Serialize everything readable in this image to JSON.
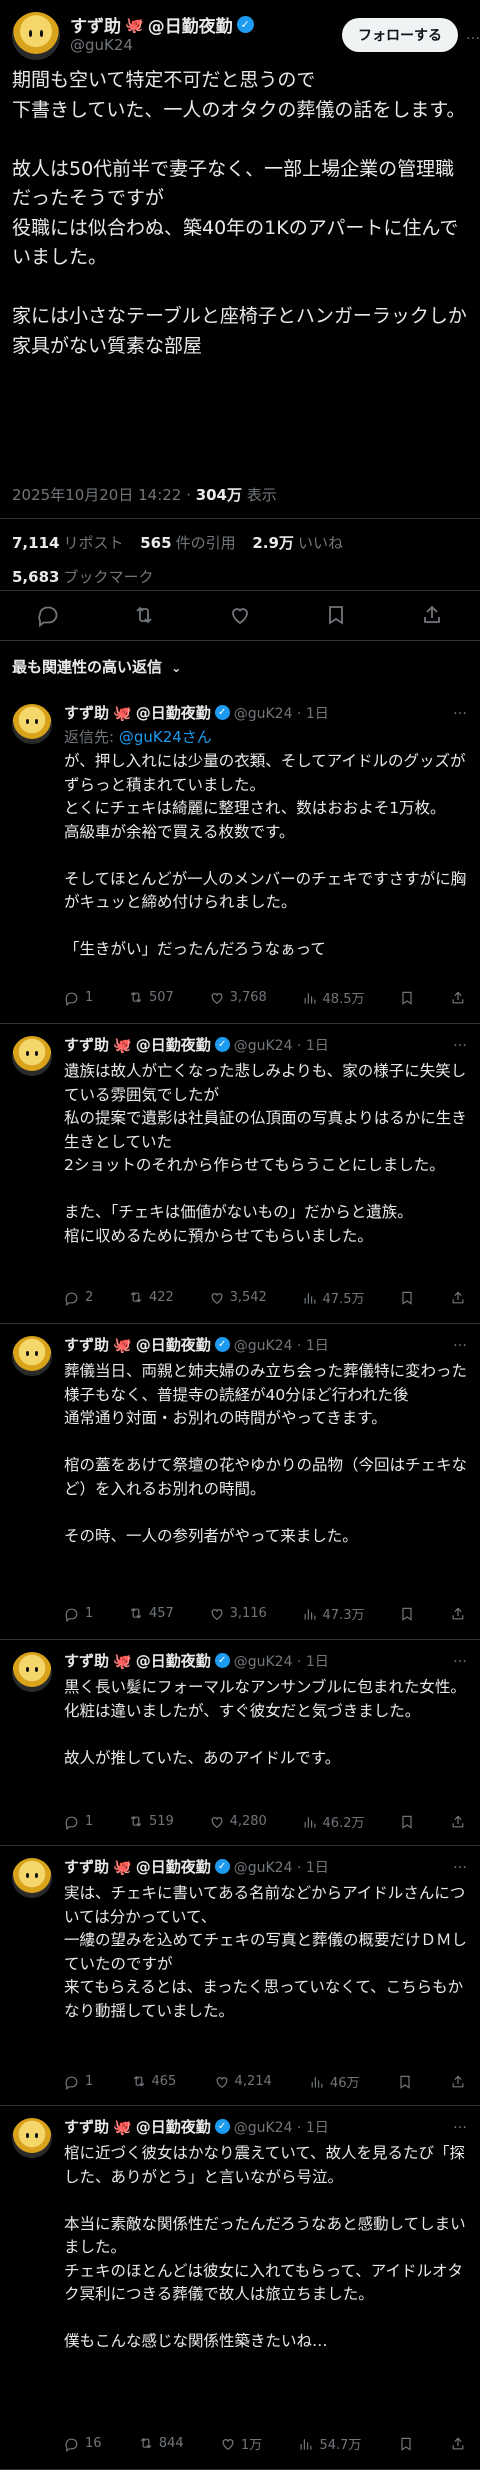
{
  "author": {
    "name": "すず助",
    "name_suffix": "@日勤夜勤",
    "emoji": "🐙",
    "handle": "@guK24",
    "verified_mark": "✓",
    "follow_label": "フォローする",
    "more_label": "…"
  },
  "post": {
    "text": "期間も空いて特定不可だと思うので\n下書きしていた、一人のオタクの葬儀の話をします。\n\n故人は50代前半で妻子なく、一部上場企業の管理職だったそうですが\n役職には似合わぬ、築40年の1Kのアパートに住んでいました。\n\n家には小さなテーブルと座椅子とハンガーラックしか家具がない質素な部屋",
    "date": "2025年10月20日 14:22",
    "separator": "·",
    "views_value": "304万",
    "views_label": "表示",
    "reposts_value": "7,114",
    "reposts_label": "リポスト",
    "quotes_value": "565",
    "quotes_label": "件の引用",
    "likes_value": "2.9万",
    "likes_label": "いいね",
    "bookmarks_value": "5,683",
    "bookmarks_label": "ブックマーク"
  },
  "sort": {
    "label": "最も関連性の高い返信",
    "chevron": "⌄"
  },
  "replies": [
    {
      "name": "すず助",
      "suffix": "@日勤夜勤",
      "meta": "@guK24 · 1日",
      "replyto_prefix": "返信先: ",
      "replyto_handle": "@guK24さん",
      "text": "が、押し入れには少量の衣類、そしてアイドルのグッズがずらっと積まれていました。\nとくにチェキは綺麗に整理され、数はおおよそ1万枚。\n高級車が余裕で買える枚数です。\n\nそしてほとんどが一人のメンバーのチェキですさすがに胸がキュッと締め付けられました。\n\n「生きがい」だったんだろうなぁって",
      "replies": "1",
      "reposts": "507",
      "likes": "3,768",
      "views": "48.5万"
    },
    {
      "name": "すず助",
      "suffix": "@日勤夜勤",
      "meta": "@guK24 · 1日",
      "text": "遺族は故人が亡くなった悲しみよりも、家の様子に失笑している雰囲気でしたが\n私の提案で遺影は社員証の仏頂面の写真よりはるかに生き生きとしていた\n2ショットのそれから作らせてもらうことにしました。\n\nまた、「チェキは価値がないもの」だからと遺族。\n棺に収めるために預からせてもらいました。",
      "replies": "2",
      "reposts": "422",
      "likes": "3,542",
      "views": "47.5万"
    },
    {
      "name": "すず助",
      "suffix": "@日勤夜勤",
      "meta": "@guK24 · 1日",
      "text": "葬儀当日、両親と姉夫婦のみ立ち会った葬儀特に変わった様子もなく、普提寺の読経が40分ほど行われた後\n通常通り対面・お別れの時間がやってきます。\n\n棺の蓋をあけて祭壇の花やゆかりの品物（今回はチェキなど）を入れるお別れの時間。\n\nその時、一人の参列者がやって来ました。",
      "replies": "1",
      "reposts": "457",
      "likes": "3,116",
      "views": "47.3万"
    },
    {
      "name": "すず助",
      "suffix": "@日勤夜勤",
      "meta": "@guK24 · 1日",
      "text": "黒く長い髪にフォーマルなアンサンブルに包まれた女性。\n化粧は違いましたが、すぐ彼女だと気づきました。\n\n故人が推していた、あのアイドルです。",
      "replies": "1",
      "reposts": "519",
      "likes": "4,280",
      "views": "46.2万"
    },
    {
      "name": "すず助",
      "suffix": "@日勤夜勤",
      "meta": "@guK24 · 1日",
      "text": "実は、チェキに書いてある名前などからアイドルさんについては分かっていて、\n一縷の望みを込めてチェキの写真と葬儀の概要だけＤＭしていたのですが\n来てもらえるとは、まったく思っていなくて、こちらもかなり動揺していました。",
      "replies": "1",
      "reposts": "465",
      "likes": "4,214",
      "views": "46万"
    },
    {
      "name": "すず助",
      "suffix": "@日勤夜勤",
      "meta": "@guK24 · 1日",
      "text": "棺に近づく彼女はかなり震えていて、故人を見るたび「探した、ありがとう」と言いながら号泣。\n\n本当に素敵な関係性だったんだろうなあと感動してしまいました。\nチェキのほとんどは彼女に入れてもらって、アイドルオタク冥利につきる葬儀で故人は旅立ちました。\n\n僕もこんな感じな関係性築きたいね…",
      "replies": "16",
      "reposts": "844",
      "likes": "1万",
      "views": "54.7万"
    }
  ],
  "colors": {
    "accent": "#1d9bf0",
    "background": "#000000",
    "text": "#e7e9ea",
    "muted": "#71767b",
    "divider": "#2f3336",
    "emoji": "#f91880"
  },
  "icons": [
    "reply-icon",
    "repost-icon",
    "like-icon",
    "views-icon",
    "bookmark-icon",
    "share-icon",
    "more-icon",
    "verified-icon",
    "octopus-emoji"
  ]
}
